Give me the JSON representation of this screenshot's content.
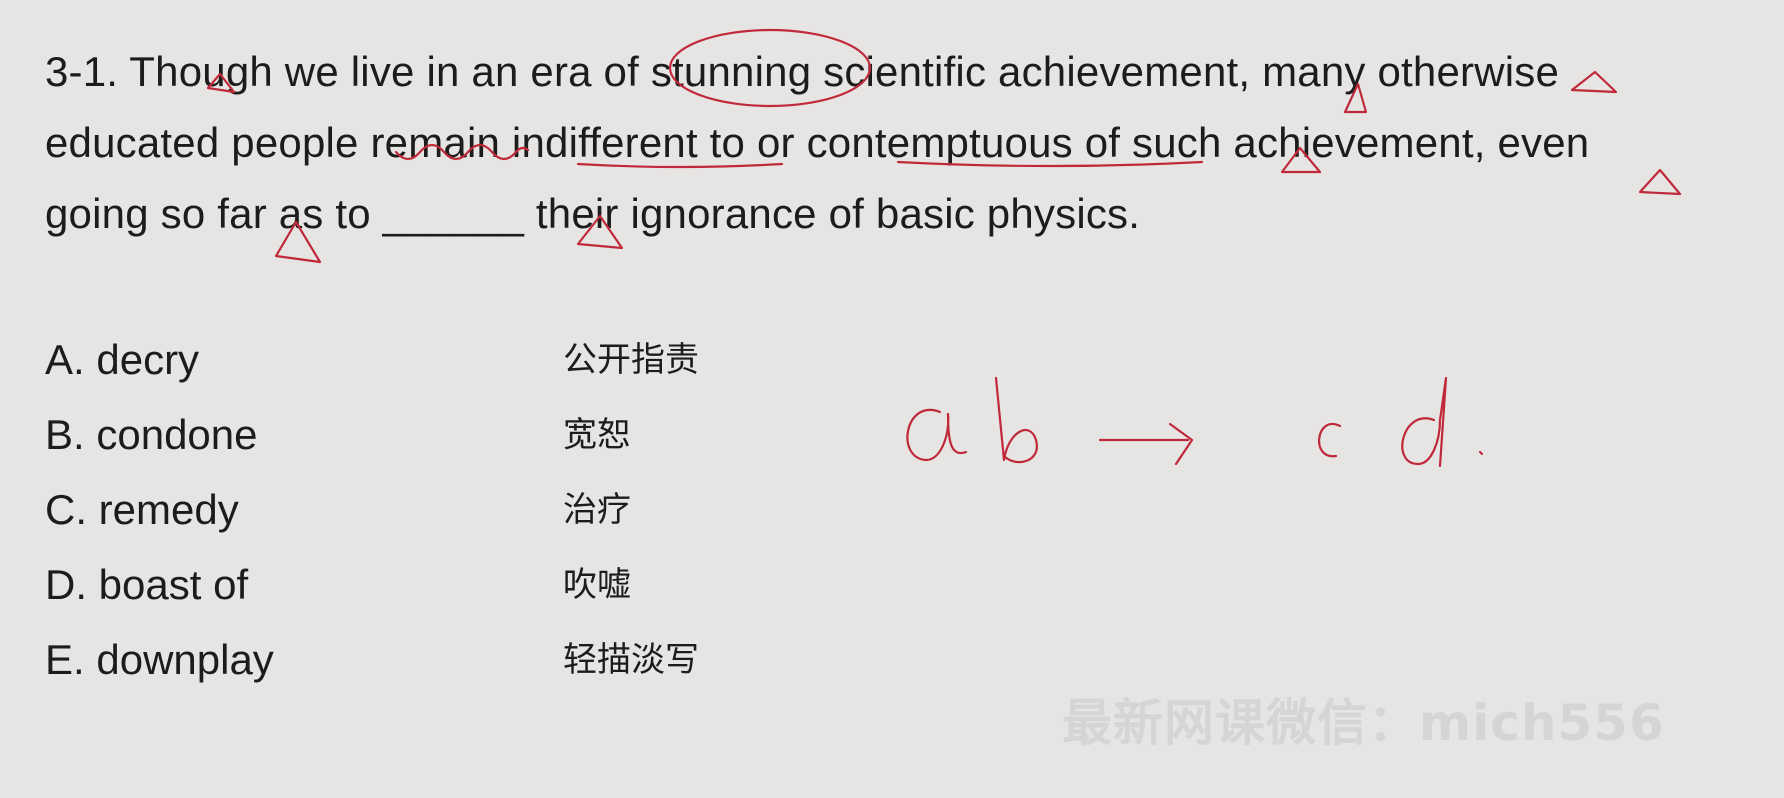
{
  "question": {
    "line1": "3-1. Though we live in an era of stunning scientific achievement, many otherwise",
    "line2": "educated people remain indifferent to or contemptuous of such achievement, even",
    "line3": "going so far as to ______ their ignorance of basic physics."
  },
  "options": [
    {
      "label": "A. decry",
      "translation": "公开指责"
    },
    {
      "label": "B. condone",
      "translation": "宽恕"
    },
    {
      "label": "C. remedy",
      "translation": "治疗"
    },
    {
      "label": "D. boast of",
      "translation": "吹嘘"
    },
    {
      "label": "E. downplay",
      "translation": "轻描淡写"
    }
  ],
  "watermark": "最新网课微信：mich556",
  "handwriting": {
    "note": "ab → cd.",
    "ink_color": "#c0293a"
  }
}
